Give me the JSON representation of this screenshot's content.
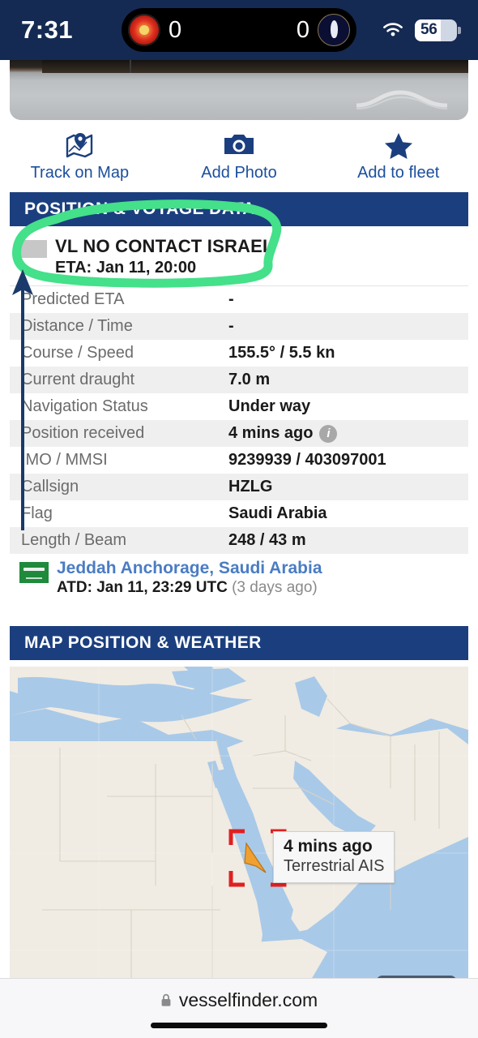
{
  "status_bar": {
    "time": "7:31",
    "live_activity": {
      "home_team_icon": "man-utd-crest-icon",
      "home_score": "0",
      "away_score": "0",
      "away_team_icon": "tottenham-crest-icon"
    },
    "wifi_icon": "wifi-icon",
    "battery_percent": "56"
  },
  "photo": {
    "alt": "vessel-photo",
    "watermark": "watermark-icon"
  },
  "actions": [
    {
      "label": "Track on Map",
      "icon": "map-pin-icon"
    },
    {
      "label": "Add Photo",
      "icon": "camera-icon"
    },
    {
      "label": "Add to fleet",
      "icon": "star-icon"
    }
  ],
  "position_section": {
    "header": "POSITION & VOYAGE DATA",
    "destination": "VL NO CONTACT ISRAEL",
    "eta": "ETA: Jan 11, 20:00",
    "rows": [
      {
        "label": "Predicted ETA",
        "value": "-"
      },
      {
        "label": "Distance / Time",
        "value": "-"
      },
      {
        "label": "Course / Speed",
        "value": "155.5° / 5.5 kn"
      },
      {
        "label": "Current draught",
        "value": "7.0 m"
      },
      {
        "label": "Navigation Status",
        "value": "Under way"
      },
      {
        "label": "Position received",
        "value": "4 mins ago",
        "info_icon": "info-icon"
      },
      {
        "label": "IMO / MMSI",
        "value": "9239939 / 403097001"
      },
      {
        "label": "Callsign",
        "value": "HZLG"
      },
      {
        "label": "Flag",
        "value": "Saudi Arabia"
      },
      {
        "label": "Length / Beam",
        "value": "248 / 43 m"
      }
    ],
    "departure_port": {
      "flag_icon": "saudi-arabia-flag-icon",
      "name": "Jeddah Anchorage, Saudi Arabia",
      "atd": "ATD: Jan 11, 23:29 UTC",
      "ago": "(3 days ago)"
    }
  },
  "map_section": {
    "header": "MAP POSITION & WEATHER",
    "callout_time": "4 mins ago",
    "callout_source": "Terrestrial AIS",
    "vessel_marker_icon": "vessel-arrow-icon",
    "marker_box_icon": "red-bracket-icon",
    "control_icon": "map-control-icon"
  },
  "browser_bar": {
    "lock_icon": "lock-icon",
    "url": "vesselfinder.com"
  },
  "annotations": {
    "circle_color": "#44e08a",
    "arrow_color": "#1b3a6b"
  },
  "colors": {
    "header_blue": "#1b3f7e",
    "status_blue": "#152a52",
    "link_blue": "#1b4f9c",
    "port_blue": "#4a7cc4"
  }
}
